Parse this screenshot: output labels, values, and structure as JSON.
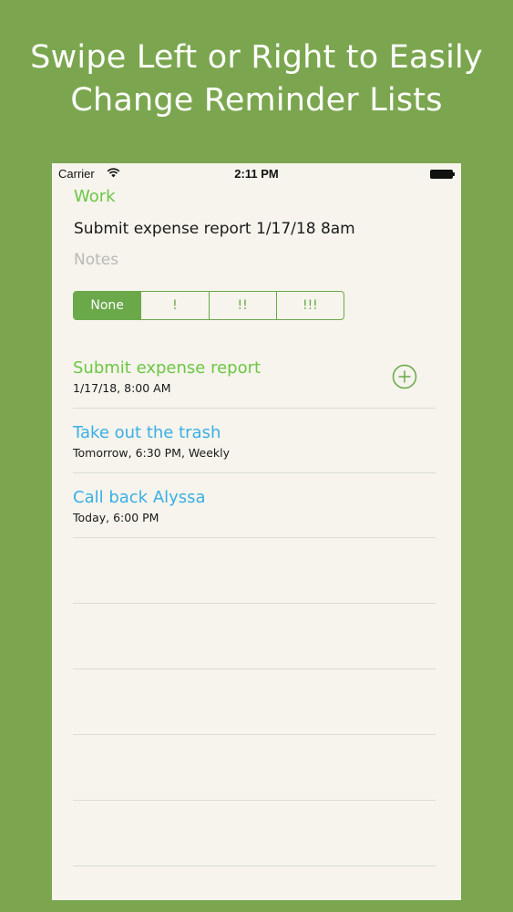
{
  "headline": {
    "line1": "Swipe Left or Right to Easily",
    "line2": "Change Reminder Lists"
  },
  "status_bar": {
    "carrier": "Carrier",
    "time": "2:11 PM",
    "wifi_icon": "wifi-icon",
    "battery_icon": "battery-icon"
  },
  "editor": {
    "list_name": "Work",
    "title_value": "Submit expense report 1/17/18 8am",
    "notes_placeholder": "Notes",
    "priority_options": [
      "None",
      "!",
      "!!",
      "!!!"
    ],
    "priority_selected": "None"
  },
  "reminders": [
    {
      "title": "Submit expense report",
      "subtitle": "1/17/18, 8:00 AM",
      "color": "#6cc644",
      "icon": "add-circle-icon"
    },
    {
      "title": "Take out the trash",
      "subtitle": "Tomorrow, 6:30 PM, Weekly",
      "color": "#3aaee6"
    },
    {
      "title": "Call back Alyssa",
      "subtitle": "Today, 6:00 PM",
      "color": "#3aaee6"
    }
  ],
  "colors": {
    "background": "#7ba64f",
    "accent_green": "#6cc644",
    "segment_green": "#6aa84a",
    "reminder_blue": "#3aaee6",
    "paper": "#f6f4ec"
  }
}
